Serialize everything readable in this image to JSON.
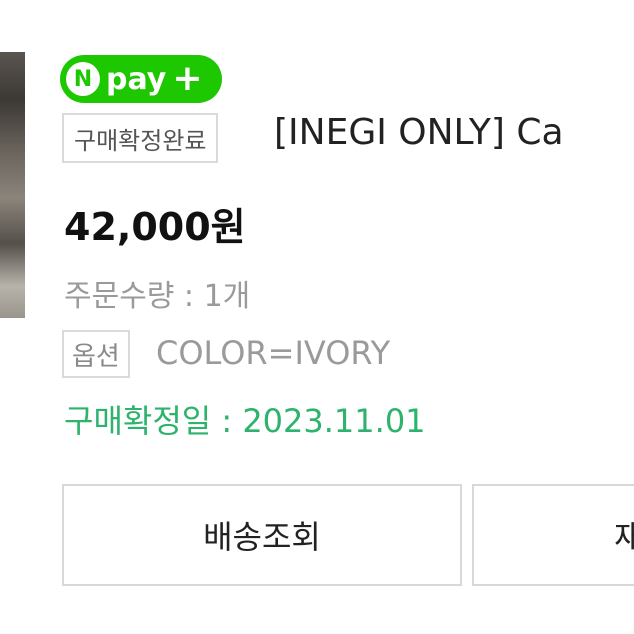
{
  "npay": {
    "n_letter": "N",
    "label": "pay",
    "plus": "+",
    "brand_color": "#1ec800"
  },
  "order": {
    "status_badge": "구매확정완료",
    "product_title": "[INEGI ONLY] Ca",
    "price": "42,000원",
    "quantity": "주문수량 : 1개",
    "option_label": "옵션",
    "option_value": "COLOR=IVORY",
    "confirm_date": "구매확정일 : 2023.11.01",
    "confirm_color": "#2db36b"
  },
  "actions": {
    "track_label": "배송조회",
    "next_label": "재"
  },
  "icons": {
    "npay_logo": "npay-logo-icon"
  }
}
